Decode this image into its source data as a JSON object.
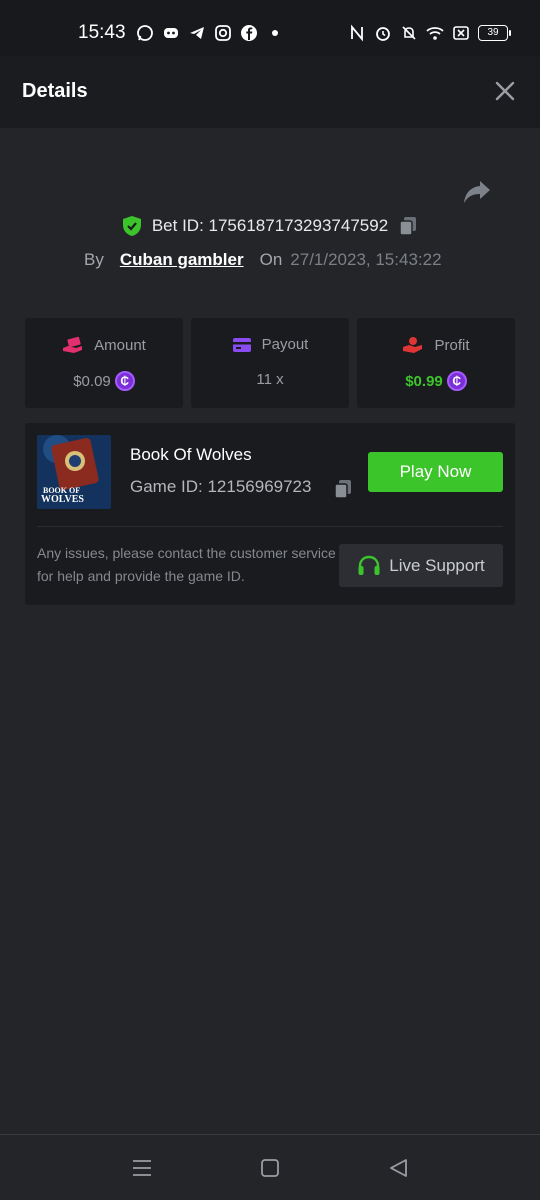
{
  "status_bar": {
    "time": "15:43",
    "battery": "39",
    "left_icons": [
      "whatsapp-icon",
      "discord-icon",
      "telegram-icon",
      "instagram-icon",
      "facebook-icon",
      "dot-icon"
    ],
    "right_icons": [
      "nfc-icon",
      "alarm-icon",
      "mute-icon",
      "wifi-icon",
      "sim-off-icon",
      "battery-icon"
    ]
  },
  "header": {
    "title": "Details"
  },
  "bet": {
    "id_text": "Bet ID: 1756187173293747592",
    "by_label": "By",
    "user": "Cuban gambler",
    "on_label": "On",
    "date": "27/1/2023, 15:43:22"
  },
  "stats": {
    "amount": {
      "label": "Amount",
      "value": "$0.09"
    },
    "payout": {
      "label": "Payout",
      "value": "11 x"
    },
    "profit": {
      "label": "Profit",
      "value": "$0.99"
    }
  },
  "game": {
    "title": "Book Of Wolves",
    "id_text": "Game ID: 12156969723",
    "thumb_text": "BOOK OF WOLVES",
    "play_label": "Play Now",
    "issue_text": "Any issues, please contact the customer service for help and provide the game ID.",
    "support_label": "Live Support"
  },
  "colors": {
    "accent_green": "#3cc42b",
    "coin_purple": "#7b2fd6",
    "background": "#232529"
  }
}
